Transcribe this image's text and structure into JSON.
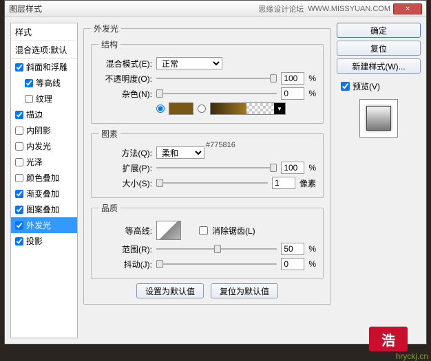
{
  "window": {
    "title": "图层样式",
    "ext_title": "思缘设计论坛",
    "ext_url": "WWW.MISSYUAN.COM"
  },
  "sidebar": {
    "header": "样式",
    "blend_default": "混合选项:默认",
    "items": [
      {
        "label": "斜面和浮雕",
        "checked": true
      },
      {
        "label": "等高线",
        "checked": true,
        "indent": true
      },
      {
        "label": "纹理",
        "checked": false,
        "indent": true
      },
      {
        "label": "描边",
        "checked": true
      },
      {
        "label": "内阴影",
        "checked": false
      },
      {
        "label": "内发光",
        "checked": false
      },
      {
        "label": "光泽",
        "checked": false
      },
      {
        "label": "颜色叠加",
        "checked": false
      },
      {
        "label": "渐变叠加",
        "checked": true
      },
      {
        "label": "图案叠加",
        "checked": true
      },
      {
        "label": "外发光",
        "checked": true,
        "selected": true
      },
      {
        "label": "投影",
        "checked": true
      }
    ]
  },
  "panel": {
    "title": "外发光",
    "struct": {
      "legend": "结构",
      "blend_label": "混合模式(E):",
      "blend_value": "正常",
      "opacity_label": "不透明度(O):",
      "opacity_value": "100",
      "opacity_unit": "%",
      "noise_label": "杂色(N):",
      "noise_value": "0",
      "noise_unit": "%",
      "color_hex": "#775816"
    },
    "elem": {
      "legend": "图素",
      "method_label": "方法(Q):",
      "method_value": "柔和",
      "spread_label": "扩展(P):",
      "spread_value": "100",
      "spread_unit": "%",
      "size_label": "大小(S):",
      "size_value": "1",
      "size_unit": "像素"
    },
    "qual": {
      "legend": "品质",
      "contour_label": "等高线:",
      "anti_label": "消除锯齿(L)",
      "range_label": "范围(R):",
      "range_value": "50",
      "range_unit": "%",
      "jitter_label": "抖动(J):",
      "jitter_value": "0",
      "jitter_unit": "%"
    },
    "set_default": "设置为默认值",
    "reset_default": "复位为默认值"
  },
  "buttons": {
    "ok": "确定",
    "cancel": "复位",
    "new_style": "新建样式(W)...",
    "preview": "预览(V)"
  },
  "watermark": "hryckj.cn",
  "logo": "浩"
}
